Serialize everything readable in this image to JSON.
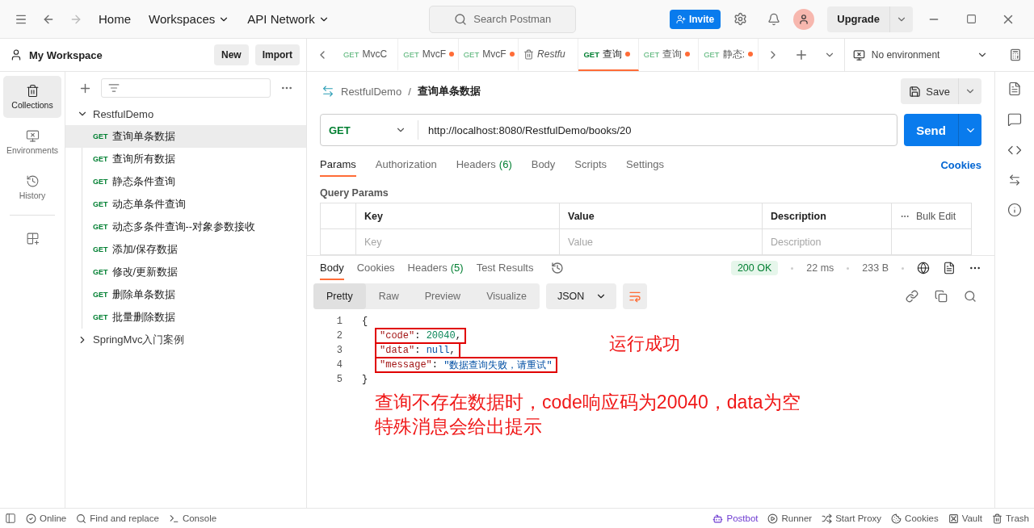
{
  "titlebar": {
    "nav": [
      "Home",
      "Workspaces",
      "API Network"
    ],
    "search": {
      "placeholder": "Search Postman"
    },
    "invite": "Invite",
    "upgrade": "Upgrade"
  },
  "workspace": {
    "name": "My Workspace",
    "buttons": [
      "New",
      "Import"
    ]
  },
  "rail": [
    {
      "label": "Collections",
      "selected": true
    },
    {
      "label": "Environments",
      "selected": false
    },
    {
      "label": "History",
      "selected": false
    }
  ],
  "collections": [
    {
      "name": "RestfulDemo",
      "expanded": true,
      "children": [
        {
          "method": "GET",
          "name": "查询单条数据",
          "selected": true
        },
        {
          "method": "GET",
          "name": "查询所有数据",
          "selected": false
        },
        {
          "method": "GET",
          "name": "静态条件查询",
          "selected": false
        },
        {
          "method": "GET",
          "name": "动态单条件查询",
          "selected": false
        },
        {
          "method": "GET",
          "name": "动态多条件查询--对象参数接收",
          "selected": false
        },
        {
          "method": "GET",
          "name": "添加/保存数据",
          "selected": false
        },
        {
          "method": "GET",
          "name": "修改/更新数据",
          "selected": false
        },
        {
          "method": "GET",
          "name": "删除单条数据",
          "selected": false
        },
        {
          "method": "GET",
          "name": "批量删除数据",
          "selected": false
        }
      ]
    },
    {
      "name": "SpringMvc入门案例",
      "expanded": false
    }
  ],
  "tabs": [
    {
      "kind": "request",
      "method": "GET",
      "name": "MvcC",
      "unsaved": false,
      "selected": false
    },
    {
      "kind": "request",
      "method": "GET",
      "name": "MvcF",
      "unsaved": true,
      "selected": false
    },
    {
      "kind": "request",
      "method": "GET",
      "name": "MvcF",
      "unsaved": true,
      "selected": false
    },
    {
      "kind": "collection",
      "name": "Restfu",
      "unsaved": false,
      "selected": false
    },
    {
      "kind": "request",
      "method": "GET",
      "name": "查询 ",
      "unsaved": true,
      "selected": true
    },
    {
      "kind": "request",
      "method": "GET",
      "name": "查询",
      "unsaved": true,
      "selected": false
    },
    {
      "kind": "request",
      "method": "GET",
      "name": "静态:",
      "unsaved": true,
      "selected": false
    }
  ],
  "environment": "No environment",
  "request": {
    "breadcrumb": [
      "RestfulDemo",
      "查询单条数据"
    ],
    "separator": "/",
    "save": "Save",
    "method": "GET",
    "url": "http://localhost:8080/RestfulDemo/books/20",
    "send": "Send",
    "tabs": [
      {
        "label": "Params",
        "selected": true
      },
      {
        "label": "Authorization",
        "selected": false
      },
      {
        "label": "Headers",
        "count": "(6)",
        "selected": false
      },
      {
        "label": "Body",
        "selected": false
      },
      {
        "label": "Scripts",
        "selected": false
      },
      {
        "label": "Settings",
        "selected": false
      }
    ],
    "cookies": "Cookies",
    "section": "Query Params",
    "columns": [
      "Key",
      "Value",
      "Description"
    ],
    "bulk_edit": "Bulk Edit",
    "placeholders": [
      "Key",
      "Value",
      "Description"
    ]
  },
  "response": {
    "tabs": [
      {
        "label": "Body",
        "selected": true
      },
      {
        "label": "Cookies",
        "selected": false
      },
      {
        "label": "Headers",
        "count": "(5)",
        "selected": false
      },
      {
        "label": "Test Results",
        "selected": false
      }
    ],
    "status": "200 OK",
    "time": "22 ms",
    "size": "233 B",
    "views": [
      {
        "label": "Pretty",
        "selected": true
      },
      {
        "label": "Raw",
        "selected": false
      },
      {
        "label": "Preview",
        "selected": false
      },
      {
        "label": "Visualize",
        "selected": false
      }
    ],
    "format": "JSON",
    "lines": [
      {
        "number": "1",
        "boxed": false,
        "tokens": [
          {
            "kind": "punct",
            "text": "{"
          }
        ]
      },
      {
        "number": "2",
        "boxed": true,
        "tokens": [
          {
            "kind": "key",
            "text": "\"code\""
          },
          {
            "kind": "punct",
            "text": ": "
          },
          {
            "kind": "number",
            "text": "20040"
          },
          {
            "kind": "punct",
            "text": ","
          }
        ]
      },
      {
        "number": "3",
        "boxed": true,
        "tokens": [
          {
            "kind": "key",
            "text": "\"data\""
          },
          {
            "kind": "punct",
            "text": ": "
          },
          {
            "kind": "null",
            "text": "null"
          },
          {
            "kind": "punct",
            "text": ","
          }
        ]
      },
      {
        "number": "4",
        "boxed": true,
        "tokens": [
          {
            "kind": "key",
            "text": "\"message\""
          },
          {
            "kind": "punct",
            "text": ": "
          },
          {
            "kind": "string",
            "text": "\"数据查询失败，请重试\""
          }
        ]
      },
      {
        "number": "5",
        "boxed": false,
        "tokens": [
          {
            "kind": "punct",
            "text": "}"
          }
        ]
      }
    ],
    "notes": [
      "运行成功",
      "查询不存在数据时，code响应码为20040，data为空",
      "特殊消息会给出提示"
    ]
  },
  "status_bar": {
    "left": [
      "Online",
      "Find and replace",
      "Console"
    ],
    "right": [
      "Postbot",
      "Runner",
      "Start Proxy",
      "Cookies",
      "Vault",
      "Trash"
    ]
  }
}
